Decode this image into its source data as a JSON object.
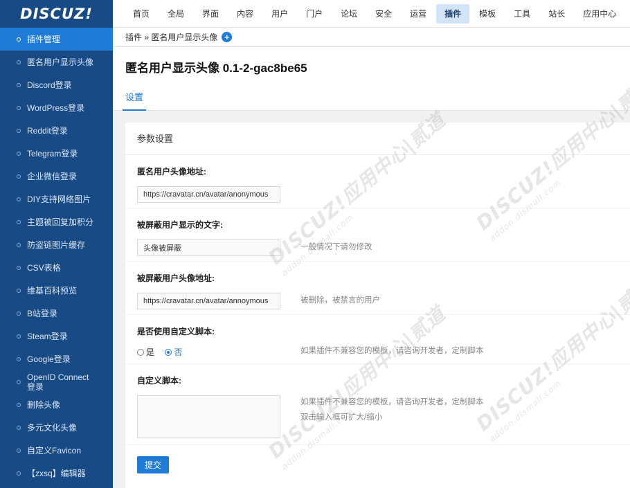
{
  "brand": {
    "logo": "DISCUZ!"
  },
  "topnav": [
    "首页",
    "全局",
    "界面",
    "内容",
    "用户",
    "门户",
    "论坛",
    "安全",
    "运营",
    "插件",
    "模板",
    "工具",
    "站长",
    "应用中心"
  ],
  "topnav_active": "插件",
  "sidebar": {
    "items": [
      {
        "label": "插件管理",
        "active": true
      },
      {
        "label": "匿名用户显示头像"
      },
      {
        "label": "Discord登录"
      },
      {
        "label": "WordPress登录"
      },
      {
        "label": "Reddit登录"
      },
      {
        "label": "Telegram登录"
      },
      {
        "label": "企业微信登录"
      },
      {
        "label": "DIY支持网络图片"
      },
      {
        "label": "主题被回复加积分"
      },
      {
        "label": "防盗链图片缓存"
      },
      {
        "label": "CSV表格"
      },
      {
        "label": "维基百科预览"
      },
      {
        "label": "B站登录"
      },
      {
        "label": "Steam登录"
      },
      {
        "label": "Google登录"
      },
      {
        "label": "OpenID Connect 登录"
      },
      {
        "label": "删除头像"
      },
      {
        "label": "多元文化头像"
      },
      {
        "label": "自定义Favicon"
      },
      {
        "label": "【zxsq】编辑器"
      }
    ]
  },
  "breadcrumb": "插件 » 匿名用户显示头像",
  "page_title": "匿名用户显示头像 0.1-2-gac8be65",
  "tabs": [
    "设置"
  ],
  "panel_title": "参数设置",
  "form": {
    "anon_avatar_label": "匿名用户头像地址:",
    "anon_avatar_value": "https://cravatar.cn/avatar/anonymous",
    "blocked_text_label": "被屏蔽用户显示的文字:",
    "blocked_text_value": "头像被屏蔽",
    "blocked_text_hint": "一般情况下请勿修改",
    "blocked_avatar_label": "被屏蔽用户头像地址:",
    "blocked_avatar_value": "https://cravatar.cn/avatar/annoymous",
    "blocked_avatar_hint": "被删除，被禁言的用户",
    "custom_script_toggle_label": "是否使用自定义脚本:",
    "radio_yes": "是",
    "radio_no": "否",
    "radio_selected": "否",
    "custom_script_toggle_hint": "如果插件不兼容您的模板，请咨询开发者，定制脚本",
    "custom_script_label": "自定义脚本:",
    "custom_script_hint_1": "如果插件不兼容您的模板，请咨询开发者，定制脚本",
    "custom_script_hint_2": "双击输入框可扩大/缩小",
    "submit_label": "提交"
  },
  "watermark": {
    "main": "DISCUZ!应用中心|贰道",
    "sub": "addon.dismall.com"
  },
  "colors": {
    "sidebar_bg": "#184b86",
    "accent": "#1f7bd6",
    "active_tab_bg": "#d4e4f7"
  }
}
